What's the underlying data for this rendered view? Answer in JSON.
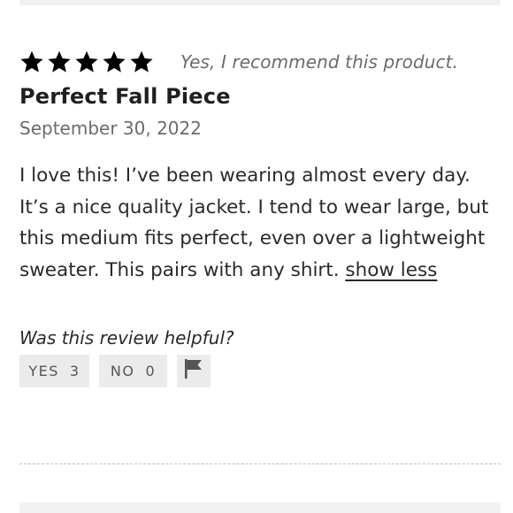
{
  "review": {
    "rating": 5,
    "max_rating": 5,
    "star_icon": "star-icon",
    "recommendation": "Yes, I recommend this product.",
    "title": "Perfect Fall Piece",
    "date": "September 30, 2022",
    "body": "I love this! I’ve been wearing almost every day. It’s a nice quality jacket. I tend to wear large, but this medium fits perfect, even over a lightweight sweater. This pairs with any shirt. ",
    "show_less_label": "show less"
  },
  "helpful": {
    "question": "Was this review helpful?",
    "yes_label": "YES",
    "yes_count": "3",
    "no_label": "NO",
    "no_count": "0",
    "flag_icon": "flag-icon"
  },
  "colors": {
    "star": "#000000",
    "muted_text": "#6b6b6b",
    "button_bg": "#ebebeb"
  }
}
